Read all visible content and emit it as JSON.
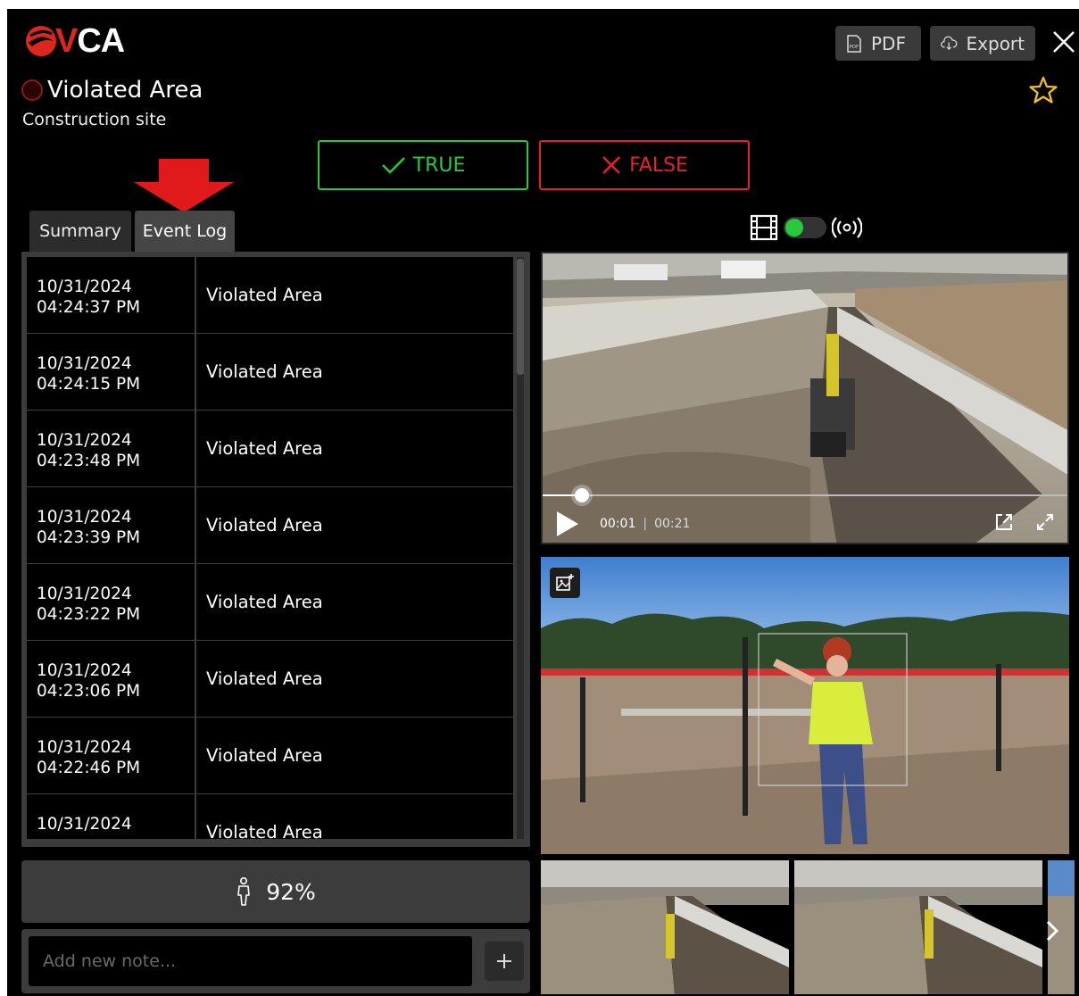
{
  "brand": {
    "logo_text": "VCA",
    "colors": {
      "accent": "#e0261b",
      "true": "#27c93f",
      "false": "#e8202a"
    }
  },
  "header": {
    "pdf_label": "PDF",
    "export_label": "Export",
    "icons": [
      "pdf-file-icon",
      "cloud-download-icon",
      "close-icon",
      "star-outline-icon"
    ]
  },
  "event": {
    "title": "Violated Area",
    "subtitle": "Construction site"
  },
  "verdict": {
    "true_label": "TRUE",
    "false_label": "FALSE"
  },
  "tabs": [
    {
      "label": "Summary",
      "active": false
    },
    {
      "label": "Event Log",
      "active": true
    }
  ],
  "event_log": [
    {
      "date": "10/31/2024",
      "time": "04:24:37 PM",
      "type": "Violated Area"
    },
    {
      "date": "10/31/2024",
      "time": "04:24:15 PM",
      "type": "Violated Area"
    },
    {
      "date": "10/31/2024",
      "time": "04:23:48 PM",
      "type": "Violated Area"
    },
    {
      "date": "10/31/2024",
      "time": "04:23:39 PM",
      "type": "Violated Area"
    },
    {
      "date": "10/31/2024",
      "time": "04:23:22 PM",
      "type": "Violated Area"
    },
    {
      "date": "10/31/2024",
      "time": "04:23:06 PM",
      "type": "Violated Area"
    },
    {
      "date": "10/31/2024",
      "time": "04:22:46 PM",
      "type": "Violated Area"
    },
    {
      "date": "10/31/2024",
      "time": "",
      "type": "Violated Area"
    }
  ],
  "confidence": {
    "value": "92%",
    "icon": "person-icon"
  },
  "note": {
    "placeholder": "Add new note...",
    "add_icon": "plus-icon"
  },
  "video": {
    "current_time": "00:01",
    "duration": "00:21",
    "progress": 0.05,
    "mode_toggle": {
      "left_icon": "film-icon",
      "right_icon": "live-broadcast-icon",
      "on": true
    }
  }
}
